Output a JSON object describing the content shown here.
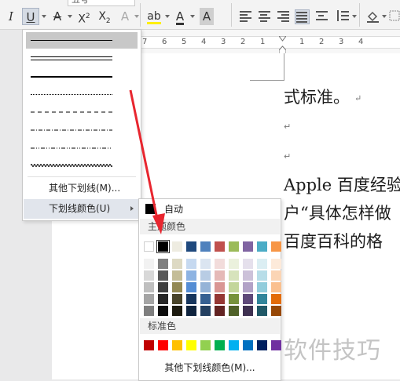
{
  "ribbon": {
    "italic": "I",
    "underline": "U",
    "strikethrough": "A",
    "superscript_base": "X",
    "superscript_exp": "2",
    "subscript_base": "X",
    "subscript_exp": "2",
    "text_effect": "A",
    "highlight": "ab",
    "font_color": "A",
    "char_shading": "A",
    "font_size_partial": "五号",
    "active_button": "underline"
  },
  "ruler": {
    "ticks": [
      "7",
      "6",
      "5",
      "4",
      "3",
      "2",
      "1",
      "1",
      "2",
      "3",
      "4"
    ]
  },
  "document": {
    "line1": "式标准。",
    "line2": "Apple 百度经验",
    "line3": "户“具体怎样做",
    "line4": "百度百科的格",
    "para_mark": "↵"
  },
  "underline_menu": {
    "styles": [
      "single",
      "double",
      "thick",
      "dotted",
      "dashed",
      "dash-dot",
      "dash-dot-dot",
      "wave"
    ],
    "selected": "single",
    "more_label": "其他下划线(M)...",
    "color_label": "下划线颜色(U)"
  },
  "color_menu": {
    "auto_label": "自动",
    "theme_header": "主题颜色",
    "standard_header": "标准色",
    "more_label": "其他下划线颜色(M)...",
    "theme_top": [
      "#ffffff",
      "#000000",
      "#eeece1",
      "#1f497d",
      "#4f81bd",
      "#c0504d",
      "#9bbb59",
      "#8064a2",
      "#4bacc6",
      "#f79646"
    ],
    "theme_shades": [
      [
        "#f2f2f2",
        "#7f7f7f",
        "#ddd9c3",
        "#c6d9f0",
        "#dbe5f1",
        "#f2dcdb",
        "#ebf1dd",
        "#e5e0ec",
        "#dbeef3",
        "#fdeada"
      ],
      [
        "#d8d8d8",
        "#595959",
        "#c4bd97",
        "#8db3e2",
        "#b8cce4",
        "#e5b9b7",
        "#d7e3bc",
        "#ccc1d9",
        "#b7dde8",
        "#fbd5b5"
      ],
      [
        "#bfbfbf",
        "#3f3f3f",
        "#938953",
        "#548dd4",
        "#95b3d7",
        "#d99694",
        "#c3d69b",
        "#b2a2c7",
        "#92cddc",
        "#fac08f"
      ],
      [
        "#a5a5a5",
        "#262626",
        "#494429",
        "#17365d",
        "#366092",
        "#953734",
        "#76923c",
        "#5f497a",
        "#31859b",
        "#e36c09"
      ],
      [
        "#7f7f7f",
        "#0c0c0c",
        "#1d1b10",
        "#0f243e",
        "#244061",
        "#632423",
        "#4f6128",
        "#3f3151",
        "#205867",
        "#974806"
      ]
    ],
    "standard": [
      "#c00000",
      "#ff0000",
      "#ffc000",
      "#ffff00",
      "#92d050",
      "#00b050",
      "#00b0f0",
      "#0070c0",
      "#002060",
      "#7030a0"
    ],
    "selected_color": "#000000"
  },
  "watermark": "软件技巧",
  "accent_arrow_color": "#e8262f"
}
